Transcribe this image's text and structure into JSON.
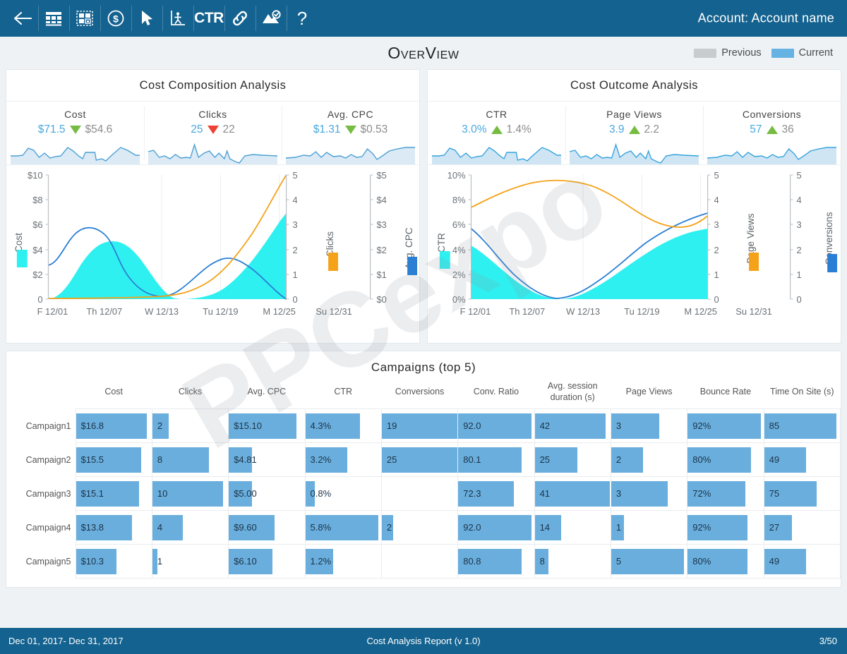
{
  "toolbar": {
    "icons": [
      {
        "name": "back-arrow-icon",
        "label": "Back"
      },
      {
        "name": "table-grid-icon",
        "label": "Table"
      },
      {
        "name": "dashed-grid-icon",
        "label": "Layout"
      },
      {
        "name": "dollar-circle-icon",
        "label": "Cost"
      },
      {
        "name": "cursor-arrow-icon",
        "label": "Select"
      },
      {
        "name": "axis-person-icon",
        "label": "Chart"
      },
      {
        "name": "ctr-text-icon",
        "label": "CTR"
      },
      {
        "name": "link-chain-icon",
        "label": "Link"
      },
      {
        "name": "image-check-icon",
        "label": "Validate"
      },
      {
        "name": "question-mark-icon",
        "label": "Help"
      }
    ],
    "ctr_label": "CTR",
    "help_label": "?",
    "account": "Account: Account name"
  },
  "header": {
    "title": "OverView",
    "legend": [
      {
        "label": "Previous",
        "color": "#c9cccf"
      },
      {
        "label": "Current",
        "color": "#66b2e2"
      }
    ]
  },
  "watermark": "PPCexpo",
  "panels": [
    {
      "title": "Cost Composition Analysis",
      "kpis": [
        {
          "name": "Cost",
          "current": "$71.5",
          "previous": "$54.6",
          "direction": "down",
          "arrow_color": "#76bc43"
        },
        {
          "name": "Clicks",
          "current": "25",
          "previous": "22",
          "direction": "down",
          "arrow_color": "#ef4136"
        },
        {
          "name": "Avg. CPC",
          "current": "$1.31",
          "previous": "$0.53",
          "direction": "down",
          "arrow_color": "#76bc43"
        }
      ]
    },
    {
      "title": "Cost Outcome Analysis",
      "kpis": [
        {
          "name": "CTR",
          "current": "3.0%",
          "previous": "1.4%",
          "direction": "up",
          "arrow_color": "#76bc43"
        },
        {
          "name": "Page Views",
          "current": "3.9",
          "previous": "2.2",
          "direction": "up",
          "arrow_color": "#76bc43"
        },
        {
          "name": "Conversions",
          "current": "57",
          "previous": "36",
          "direction": "up",
          "arrow_color": "#76bc43"
        }
      ]
    }
  ],
  "chart_data": [
    {
      "type": "area",
      "title": "Cost Composition Analysis",
      "x": [
        "F 12/01",
        "Th 12/07",
        "W 12/13",
        "Tu 12/19",
        "M 12/25",
        "Su 12/31"
      ],
      "xlabel": "",
      "grid": true,
      "legend_position": "right-axes",
      "axes": [
        {
          "name": "Cost",
          "ylabel": "Cost",
          "ticks": [
            "$10",
            "$8",
            "$6",
            "$4",
            "$2",
            "0"
          ],
          "ylim": [
            0,
            10
          ],
          "color": "#2ff0f0",
          "series_type": "area"
        },
        {
          "name": "Clicks",
          "ylabel": "Clicks",
          "ticks": [
            "5",
            "4",
            "3",
            "2",
            "1",
            "0"
          ],
          "ylim": [
            0,
            5
          ],
          "color": "#f5a218",
          "series_type": "line"
        },
        {
          "name": "Avg. CPC",
          "ylabel": "Avg. CPC",
          "ticks": [
            "$5",
            "$4",
            "$3",
            "$2",
            "$1",
            "$0"
          ],
          "ylim": [
            0,
            5
          ],
          "color": "#2a7fd4",
          "series_type": "line"
        }
      ],
      "series": [
        {
          "name": "Cost",
          "color": "#2ff0f0",
          "type": "area",
          "axis": "Cost",
          "values": [
            0.0,
            0.35,
            1.3,
            2.5,
            3.3,
            3.75,
            3.8,
            3.4,
            2.4,
            1.1,
            0.2,
            0.0,
            0.05,
            0.2,
            0.55,
            1.1,
            1.9,
            2.6,
            3.5
          ]
        },
        {
          "name": "Avg. CPC",
          "color": "#2a7fd4",
          "type": "line",
          "axis": "Avg. CPC",
          "values": [
            1.35,
            2.4,
            4.0,
            4.9,
            5.0,
            4.6,
            3.4,
            1.9,
            0.9,
            0.45,
            0.6,
            1.2,
            1.85,
            2.25,
            2.3,
            2.1,
            1.6,
            0.9,
            0.0
          ]
        },
        {
          "name": "Clicks",
          "color": "#f5a218",
          "type": "line",
          "axis": "Clicks",
          "values": [
            0.02,
            0.02,
            0.02,
            0.03,
            0.03,
            0.04,
            0.05,
            0.06,
            0.08,
            0.12,
            0.2,
            0.35,
            0.65,
            1.1,
            1.75,
            2.5,
            3.35,
            4.25,
            5.0
          ]
        }
      ]
    },
    {
      "type": "area",
      "title": "Cost Outcome Analysis",
      "x": [
        "F 12/01",
        "Th 12/07",
        "W 12/13",
        "Tu 12/19",
        "M 12/25",
        "Su 12/31"
      ],
      "xlabel": "",
      "grid": true,
      "legend_position": "right-axes",
      "axes": [
        {
          "name": "CTR",
          "ylabel": "CTR",
          "ticks": [
            "10%",
            "8%",
            "6%",
            "4%",
            "2%",
            "0%"
          ],
          "ylim": [
            0,
            10
          ],
          "color": "#2ff0f0",
          "series_type": "area"
        },
        {
          "name": "Page Views",
          "ylabel": "Page Views",
          "ticks": [
            "5",
            "4",
            "3",
            "2",
            "1",
            "0"
          ],
          "ylim": [
            0,
            5
          ],
          "color": "#f5a218",
          "series_type": "line"
        },
        {
          "name": "Conversions",
          "ylabel": "Conversions",
          "ticks": [
            "5",
            "4",
            "3",
            "2",
            "1",
            "0"
          ],
          "ylim": [
            0,
            5
          ],
          "color": "#2a7fd4",
          "series_type": "line"
        }
      ],
      "series": [
        {
          "name": "CTR",
          "color": "#2ff0f0",
          "type": "area",
          "axis": "CTR",
          "values": [
            4.3,
            3.6,
            2.9,
            2.2,
            1.6,
            1.0,
            0.5,
            0.15,
            0.05,
            0.15,
            0.45,
            0.95,
            1.5,
            2.0,
            2.35,
            2.6,
            2.8,
            2.9,
            3.0
          ]
        },
        {
          "name": "Conversions",
          "color": "#2a7fd4",
          "type": "line",
          "axis": "Conversions",
          "values": [
            5.7,
            4.7,
            3.7,
            2.8,
            2.0,
            1.3,
            0.7,
            0.25,
            0.05,
            0.3,
            0.85,
            1.5,
            2.1,
            2.6,
            3.05,
            3.4,
            3.65,
            3.8,
            3.9
          ]
        },
        {
          "name": "Page Views",
          "color": "#f5a218",
          "type": "line",
          "axis": "Page Views",
          "values": [
            7.35,
            7.8,
            8.3,
            8.75,
            9.1,
            9.3,
            9.35,
            9.3,
            9.1,
            8.7,
            8.1,
            7.5,
            7.0,
            6.9,
            6.95,
            7.05,
            7.2,
            7.45,
            7.7
          ]
        }
      ]
    }
  ],
  "campaigns": {
    "title": "Campaigns (top 5)",
    "columns": [
      "Cost",
      "Clicks",
      "Avg. CPC",
      "CTR",
      "Conversions",
      "Conv. Ratio",
      "Avg. session duration (s)",
      "Page Views",
      "Bounce Rate",
      "Time On Site (s)"
    ],
    "rows": [
      {
        "label": "Campaign1",
        "cells": [
          {
            "value": "$16.8",
            "pct": 94
          },
          {
            "value": "2",
            "pct": 22
          },
          {
            "value": "$15.10",
            "pct": 89
          },
          {
            "value": "4.3%",
            "pct": 72
          },
          {
            "value": "19",
            "pct": 100
          },
          {
            "value": "92.0",
            "pct": 97
          },
          {
            "value": "42",
            "pct": 94
          },
          {
            "value": "3",
            "pct": 63
          },
          {
            "value": "92%",
            "pct": 97
          },
          {
            "value": "85",
            "pct": 95
          }
        ]
      },
      {
        "label": "Campaign2",
        "cells": [
          {
            "value": "$15.5",
            "pct": 86
          },
          {
            "value": "8",
            "pct": 75
          },
          {
            "value": "$4.81",
            "pct": 31
          },
          {
            "value": "3.2%",
            "pct": 55
          },
          {
            "value": "25",
            "pct": 100
          },
          {
            "value": "80.1",
            "pct": 84
          },
          {
            "value": "25",
            "pct": 56
          },
          {
            "value": "2",
            "pct": 42
          },
          {
            "value": "80%",
            "pct": 84
          },
          {
            "value": "49",
            "pct": 55
          }
        ]
      },
      {
        "label": "Campaign3",
        "cells": [
          {
            "value": "$15.1",
            "pct": 83
          },
          {
            "value": "10",
            "pct": 93
          },
          {
            "value": "$5.00",
            "pct": 31
          },
          {
            "value": "0.8%",
            "pct": 13
          },
          {
            "value": "",
            "pct": 0
          },
          {
            "value": "72.3",
            "pct": 73
          },
          {
            "value": "41",
            "pct": 99
          },
          {
            "value": "3",
            "pct": 75
          },
          {
            "value": "72%",
            "pct": 76
          },
          {
            "value": "75",
            "pct": 69
          }
        ]
      },
      {
        "label": "Campaign4",
        "cells": [
          {
            "value": "$13.8",
            "pct": 74
          },
          {
            "value": "4",
            "pct": 40
          },
          {
            "value": "$9.60",
            "pct": 60
          },
          {
            "value": "5.8%",
            "pct": 96
          },
          {
            "value": "2",
            "pct": 15
          },
          {
            "value": "92.0",
            "pct": 97
          },
          {
            "value": "14",
            "pct": 35
          },
          {
            "value": "1",
            "pct": 17
          },
          {
            "value": "92%",
            "pct": 79
          },
          {
            "value": "27",
            "pct": 37
          }
        ]
      },
      {
        "label": "Campaign5",
        "cells": [
          {
            "value": "$10.3",
            "pct": 54
          },
          {
            "value": "1",
            "pct": 6
          },
          {
            "value": "$6.10",
            "pct": 58
          },
          {
            "value": "1.2%",
            "pct": 37
          },
          {
            "value": "",
            "pct": 0
          },
          {
            "value": "80.8",
            "pct": 84
          },
          {
            "value": "8",
            "pct": 18
          },
          {
            "value": "5",
            "pct": 96
          },
          {
            "value": "80%",
            "pct": 79
          },
          {
            "value": "49",
            "pct": 55
          }
        ]
      }
    ]
  },
  "footer": {
    "date_range": "Dec 01, 2017- Dec 31, 2017",
    "report": "Cost Analysis Report (v 1.0)",
    "page": "3/50"
  }
}
